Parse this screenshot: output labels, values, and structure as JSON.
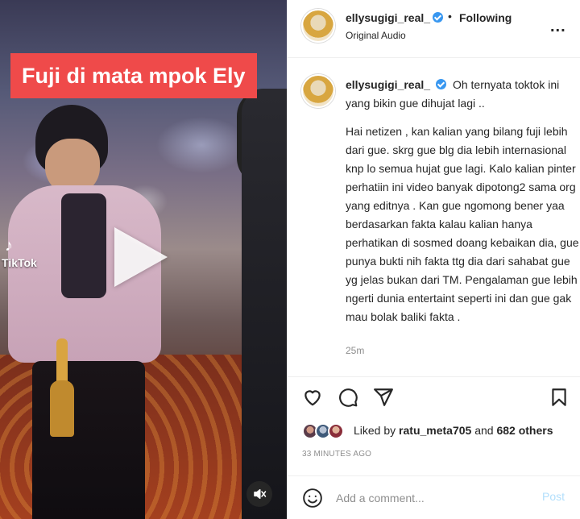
{
  "video": {
    "overlay_title": "Fuji di mata mpok Ely",
    "watermark": "TikTok"
  },
  "header": {
    "username": "ellysugigi_real_",
    "separator": "•",
    "follow_state": "Following",
    "audio": "Original Audio",
    "more": "..."
  },
  "caption": {
    "username": "ellysugigi_real_",
    "first_line": "Oh ternyata toktok ini yang bikin gue dihujat lagi ..",
    "body": "Hai netizen , kan kalian yang bilang fuji lebih dari gue. skrg gue blg dia lebih internasional knp lo semua hujat gue lagi. Kalo kalian pinter perhatiin ini video banyak dipotong2 sama org yang editnya . Kan gue ngomong bener yaa berdasarkan fakta kalau kalian hanya perhatikan di sosmed doang kebaikan dia, gue punya bukti nih fakta ttg dia dari sahabat gue yg jelas bukan dari TM. Pengalaman gue lebih ngerti dunia entertaint seperti ini dan gue gak mau bolak baliki fakta .",
    "time": "25m"
  },
  "likes": {
    "prefix": "Liked by",
    "liker": "ratu_meta705",
    "connector": "and",
    "others": "682 others"
  },
  "post_age": "33 MINUTES AGO",
  "comment": {
    "placeholder": "Add a comment...",
    "post_label": "Post"
  },
  "colors": {
    "verified": "#3897f0",
    "overlay_red": "#ef4a4a",
    "post_disabled": "#b2dffc"
  }
}
